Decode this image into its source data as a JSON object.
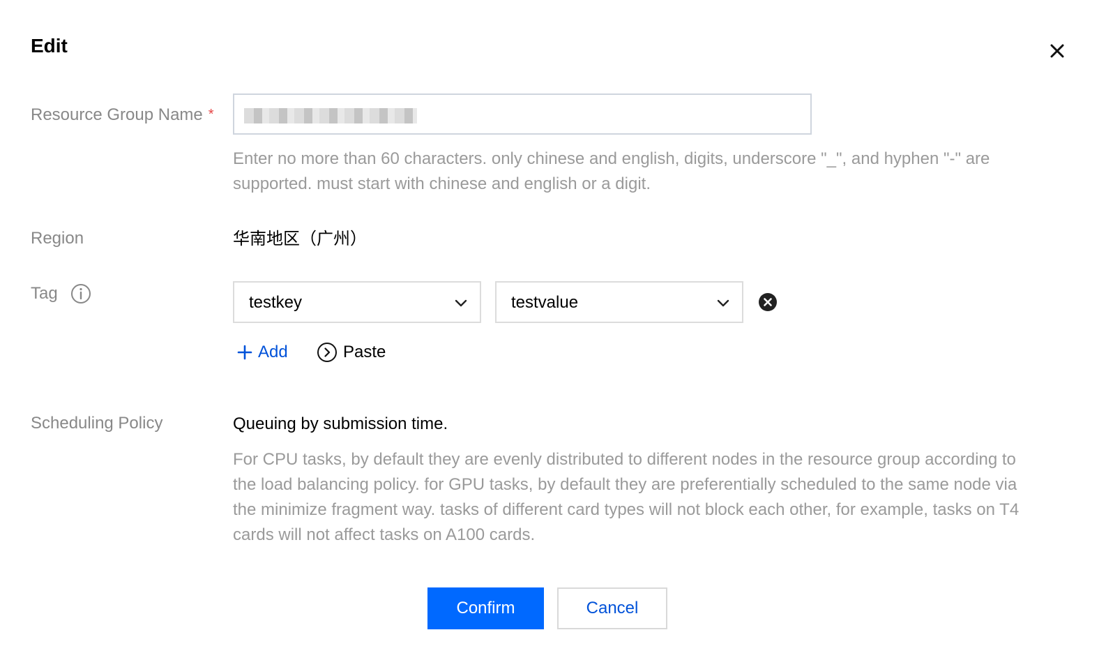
{
  "dialog": {
    "title": "Edit"
  },
  "form": {
    "name": {
      "label": "Resource Group Name",
      "required_mark": "*",
      "hint": "Enter no more than 60 characters. only chinese and english, digits, underscore \"_\", and hyphen \"-\" are supported. must start with chinese and english or a digit."
    },
    "region": {
      "label": "Region",
      "value": "华南地区（广州）"
    },
    "tag": {
      "label": "Tag",
      "key": "testkey",
      "value": "testvalue",
      "add_label": "Add",
      "paste_label": "Paste"
    },
    "policy": {
      "label": "Scheduling Policy",
      "value": "Queuing by submission time.",
      "description": "For CPU tasks, by default they are evenly distributed to different nodes in the resource group according to the load balancing policy. for GPU tasks, by default they are preferentially scheduled to the same node via the minimize fragment way. tasks of different card types will not block each other, for example, tasks on T4 cards will not affect tasks on A100 cards."
    }
  },
  "footer": {
    "confirm_label": "Confirm",
    "cancel_label": "Cancel"
  },
  "colors": {
    "primary": "#0069ff",
    "link": "#0052d9",
    "required": "#e54545",
    "label": "#888888"
  },
  "icons": {
    "close": "close-icon",
    "info": "info-icon",
    "chevron": "chevron-down-icon",
    "remove": "remove-circle-icon",
    "add": "plus-icon",
    "paste": "paste-arrow-icon"
  }
}
